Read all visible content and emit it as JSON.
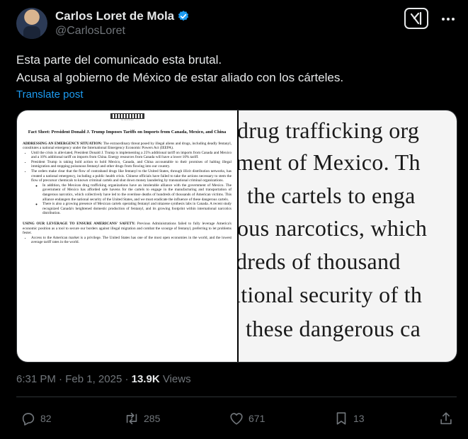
{
  "author": {
    "name": "Carlos Loret de Mola",
    "handle": "@CarlosLoret"
  },
  "tweet": {
    "line1": "Esta parte del comunicado esta brutal.",
    "line2": "Acusa al gobierno de México de estar aliado con los cárteles.",
    "translate_label": "Translate post"
  },
  "document": {
    "seal_caption": "THE WHITE HOUSE",
    "title": "Fact Sheet: President Donald J. Trump Imposes Tariffs on Imports from Canada, Mexico, and China",
    "section1_heading": "ADDRESSING AN EMERGENCY SITUATION:",
    "section1_text": "The extraordinary threat posed by illegal aliens and drugs, including deadly fentanyl, constitutes a national emergency under the International Emergency Economic Powers Act (IEEPA).",
    "bullets": [
      "Until the crisis is alleviated, President Donald J. Trump is implementing a 25% additional tariff on imports from Canada and Mexico and a 10% additional tariff on imports from China. Energy resources from Canada will have a lower 10% tariff.",
      "President Trump is taking bold action to hold Mexico, Canada, and China accountable to their promises of halting illegal immigration and stopping poisonous fentanyl and other drugs from flowing into our country.",
      "The orders make clear that the flow of contraband drugs like fentanyl to the United States, through illicit distribution networks, has created a national emergency, including a public health crisis. Chinese officials have failed to take the actions necessary to stem the flow of precursor chemicals to known criminal cartels and shut down money laundering by transnational criminal organizations."
    ],
    "sub_bullets": [
      "In addition, the Mexican drug trafficking organizations have an intolerable alliance with the government of Mexico. The government of Mexico has afforded safe havens for the cartels to engage in the manufacturing and transportation of dangerous narcotics, which collectively have led to the overdose deaths of hundreds of thousands of American victims. This alliance endangers the national security of the United States, and we must eradicate the influence of these dangerous cartels.",
      "There is also a growing presence of Mexican cartels operating fentanyl and nitazene synthesis labs in Canada. A recent study recognized Canada's heightened domestic production of fentanyl, and its growing footprint within international narcotics distribution."
    ],
    "section2_heading": "USING OUR LEVERAGE TO ENSURE AMERICANS' SAFETY:",
    "section2_text": "Previous Administrations failed to fully leverage America's economic position as a tool to secure our borders against illegal migration and combat the scourge of fentanyl, preferring to let problems fester.",
    "last_bullet": "Access to the American market is a privilege. The United States has one of the most open economies in the world, and the lowest average tariff rates in the world."
  },
  "zoom_lines": [
    "drug trafficking org",
    "ment of Mexico. Th",
    "the cartels to enga",
    "ous narcotics, which",
    "dreds of thousand",
    "itional security of th",
    "these dangerous ca"
  ],
  "meta": {
    "time": "6:31 PM",
    "dot": " · ",
    "date": "Feb 1, 2025",
    "views_count": "13.9K",
    "views_label": " Views"
  },
  "actions": {
    "replies": "82",
    "reposts": "285",
    "likes": "671",
    "bookmarks": "13"
  },
  "colors": {
    "background": "#000000",
    "link": "#1d9bf0",
    "verified": "#1d9bf0",
    "muted": "#71767b"
  }
}
